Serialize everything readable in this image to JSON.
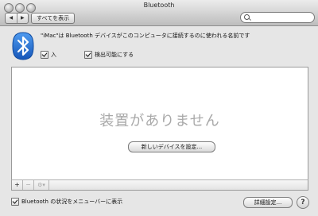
{
  "window": {
    "title": "Bluetooth"
  },
  "toolbar": {
    "back_icon": "◀",
    "forward_icon": "▶",
    "show_all_label": "すべてを表示",
    "search_value": "",
    "search_placeholder": ""
  },
  "header": {
    "device_name_text": "\"iMac\"は Bluetooth デバイスがこのコンピュータに接続するのに使われる名前です",
    "on_label": "入",
    "on_checked": true,
    "discoverable_label": "検出可能にする",
    "discoverable_checked": true
  },
  "devices": {
    "empty_text": "装置がありません",
    "new_device_label": "新しいデバイスを設定..."
  },
  "panel_bar": {
    "add_icon": "+",
    "remove_icon": "−",
    "gear_icon": "⚙▾"
  },
  "footer": {
    "show_in_menubar_label": "Bluetooth の状況をメニューバーに表示",
    "show_in_menubar_checked": true,
    "advanced_label": "詳細設定...",
    "help_icon": "?"
  },
  "colors": {
    "bluetooth_blue": "#1d6fd6"
  }
}
